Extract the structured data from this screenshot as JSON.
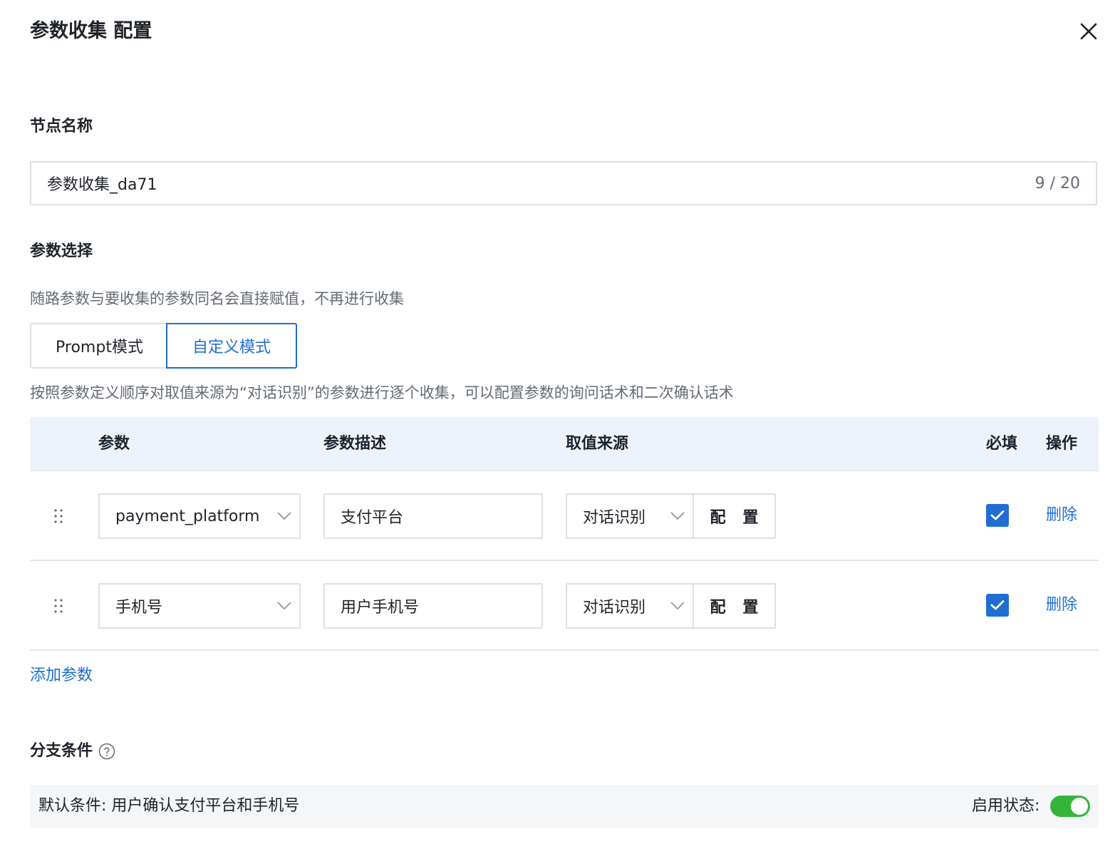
{
  "header": {
    "title": "参数收集 配置"
  },
  "node_name": {
    "label": "节点名称",
    "value": "参数收集_da71",
    "counter": "9 / 20"
  },
  "param_select": {
    "label": "参数选择",
    "hint": "随路参数与要收集的参数同名会直接赋值，不再进行收集",
    "modes": [
      "Prompt模式",
      "自定义模式"
    ],
    "active_mode": "自定义模式",
    "mode_hint": "按照参数定义顺序对取值来源为“对话识别”的参数进行逐个收集，可以配置参数的询问话术和二次确认话术"
  },
  "table": {
    "headers": {
      "param": "参数",
      "desc": "参数描述",
      "source": "取值来源",
      "required": "必填",
      "action": "操作"
    },
    "rows": [
      {
        "param": "payment_platform",
        "desc": "支付平台",
        "source": "对话识别",
        "config_label": "配 置",
        "required": true,
        "delete_label": "删除"
      },
      {
        "param": "手机号",
        "desc": "用户手机号",
        "source": "对话识别",
        "config_label": "配 置",
        "required": true,
        "delete_label": "删除"
      }
    ],
    "add_label": "添加参数"
  },
  "branch": {
    "label": "分支条件",
    "default_condition": "默认条件: 用户确认支付平台和手机号",
    "status_label": "启用状态:",
    "enabled": true
  },
  "colors": {
    "accent": "#1f6ed4",
    "toggle_on": "#34b53a",
    "table_header_bg": "#eef2fa"
  }
}
